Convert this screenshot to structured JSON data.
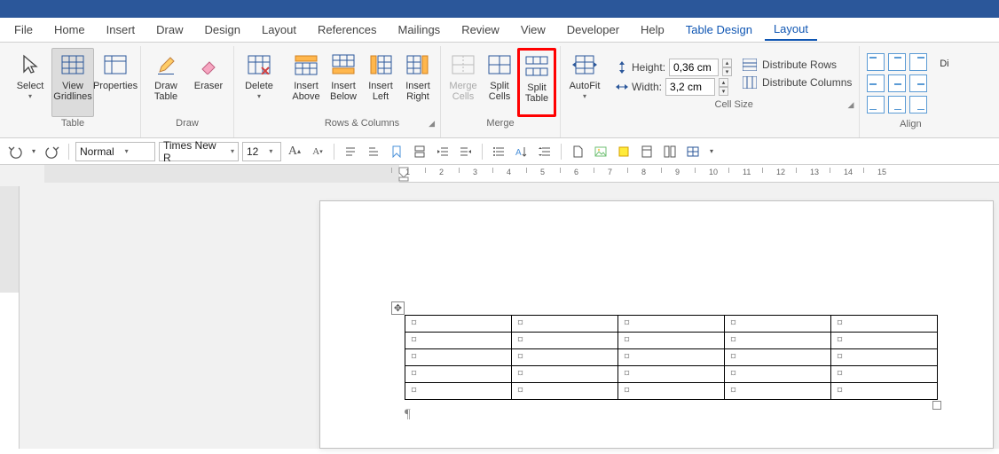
{
  "menu": {
    "file": "File",
    "home": "Home",
    "insert": "Insert",
    "draw": "Draw",
    "design": "Design",
    "layoutPage": "Layout",
    "references": "References",
    "mailings": "Mailings",
    "review": "Review",
    "view": "View",
    "developer": "Developer",
    "help": "Help",
    "tableDesign": "Table Design",
    "layout": "Layout"
  },
  "groups": {
    "table": "Table",
    "draw": "Draw",
    "rowscols": "Rows & Columns",
    "merge": "Merge",
    "cellsize": "Cell Size",
    "align": "Align"
  },
  "buttons": {
    "select": "Select",
    "viewGridlines": "View Gridlines",
    "properties": "Properties",
    "drawTable": "Draw Table",
    "eraser": "Eraser",
    "delete": "Delete",
    "insertAbove": "Insert Above",
    "insertBelow": "Insert Below",
    "insertLeft": "Insert Left",
    "insertRight": "Insert Right",
    "mergeCells": "Merge Cells",
    "splitCells": "Split Cells",
    "splitTable": "Split Table",
    "autofit": "AutoFit",
    "distRows": "Distribute Rows",
    "distCols": "Distribute Columns",
    "textDir": "Di"
  },
  "cellSize": {
    "heightLabel": "Height:",
    "heightVal": "0,36 cm",
    "widthLabel": "Width:",
    "widthVal": "3,2 cm"
  },
  "qat": {
    "style": "Normal",
    "font": "Times New R",
    "size": "12"
  },
  "ruler": [
    "1",
    "2",
    "3",
    "4",
    "5",
    "6",
    "7",
    "8",
    "9",
    "10",
    "11",
    "12",
    "13",
    "14",
    "15"
  ],
  "cellMark": "¤",
  "paraMark": "¶"
}
